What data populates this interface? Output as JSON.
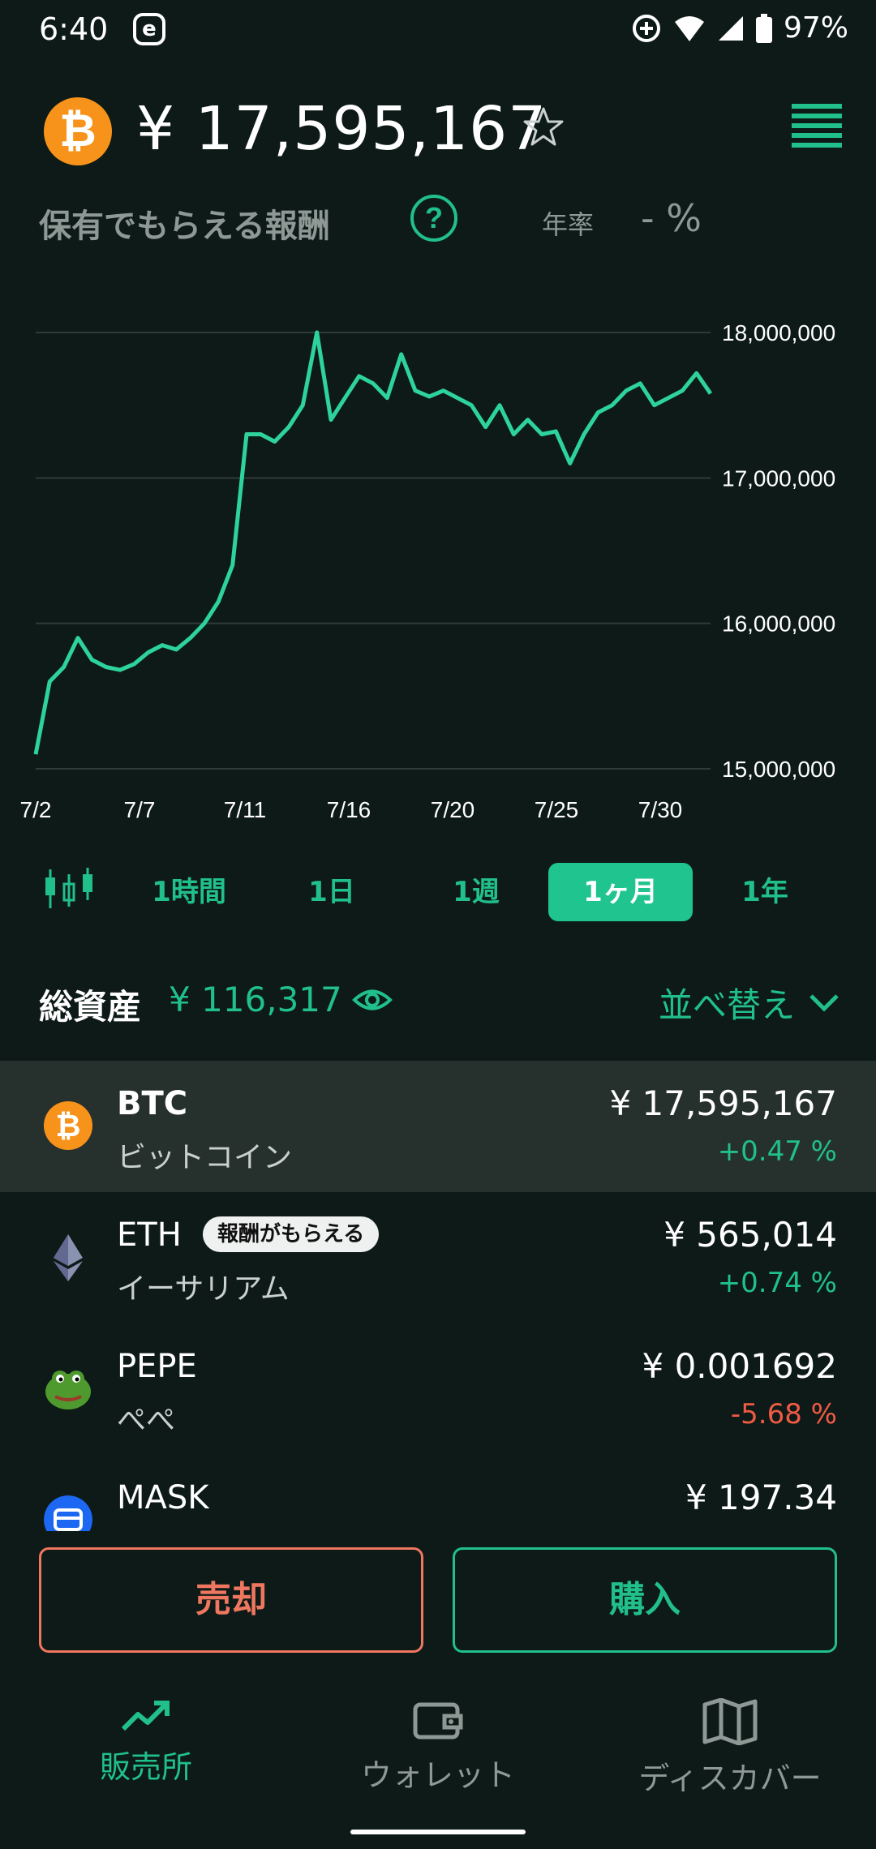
{
  "status": {
    "time": "6:40",
    "app_badge": "e",
    "battery": "97%"
  },
  "header": {
    "coin_symbol_glyph": "₿",
    "price": "¥ 17,595,167",
    "star_icon": "star-outline-icon",
    "menu_icon": "list-menu-icon"
  },
  "rewards": {
    "label": "保有でもらえる報酬",
    "rate_label": "年率",
    "rate_value": "- %"
  },
  "chart_data": {
    "type": "line",
    "y_ticks": [
      "18,000,000",
      "17,000,000",
      "16,000,000",
      "15,000,000"
    ],
    "x_ticks": [
      "7/2",
      "7/7",
      "7/11",
      "7/16",
      "7/20",
      "7/25",
      "7/30"
    ],
    "ylim": [
      15000000,
      18000000
    ],
    "grid": true,
    "color": "#2ed39b",
    "series": [
      {
        "values": [
          15100000,
          15600000,
          15700000,
          15900000,
          15750000,
          15700000,
          15680000,
          15720000,
          15800000,
          15850000,
          15820000,
          15900000,
          16000000,
          16150000,
          16400000,
          17300000,
          17300000,
          17250000,
          17350000,
          17500000,
          18000000,
          17400000,
          17550000,
          17700000,
          17650000,
          17550000,
          17850000,
          17600000,
          17560000,
          17600000,
          17550000,
          17500000,
          17350000,
          17500000,
          17300000,
          17400000,
          17300000,
          17320000,
          17100000,
          17300000,
          17450000,
          17500000,
          17600000,
          17650000,
          17500000,
          17550000,
          17600000,
          17720000,
          17580000
        ]
      }
    ]
  },
  "periods": {
    "candle_icon": "candlestick-icon",
    "items": [
      "1時間",
      "1日",
      "1週",
      "1ヶ月",
      "1年"
    ],
    "active": "1ヶ月"
  },
  "total": {
    "label": "総資産",
    "value": "¥ 116,317",
    "eye_icon": "eye-icon",
    "sort_label": "並べ替え"
  },
  "assets": [
    {
      "symbol": "BTC",
      "name": "ビットコイン",
      "price": "¥ 17,595,167",
      "change": "+0.47 %",
      "direction": "up",
      "badge": ""
    },
    {
      "symbol": "ETH",
      "name": "イーサリアム",
      "price": "¥ 565,014",
      "change": "+0.74 %",
      "direction": "up",
      "badge": "報酬がもらえる"
    },
    {
      "symbol": "PEPE",
      "name": "ぺぺ",
      "price": "¥ 0.001692",
      "change": "-5.68 %",
      "direction": "down",
      "badge": ""
    },
    {
      "symbol": "MASK",
      "name": "",
      "price": "¥ 197.34",
      "change": "",
      "direction": "up",
      "badge": ""
    }
  ],
  "actions": {
    "sell": "売却",
    "buy": "購入"
  },
  "nav": {
    "items": [
      {
        "label": "販売所",
        "icon": "trending-up-icon"
      },
      {
        "label": "ウォレット",
        "icon": "wallet-icon"
      },
      {
        "label": "ディスカバー",
        "icon": "map-icon"
      }
    ]
  },
  "colors": {
    "accent": "#21c08b",
    "sell": "#f0775f",
    "down": "#f05a44",
    "background": "#0d1a17"
  }
}
